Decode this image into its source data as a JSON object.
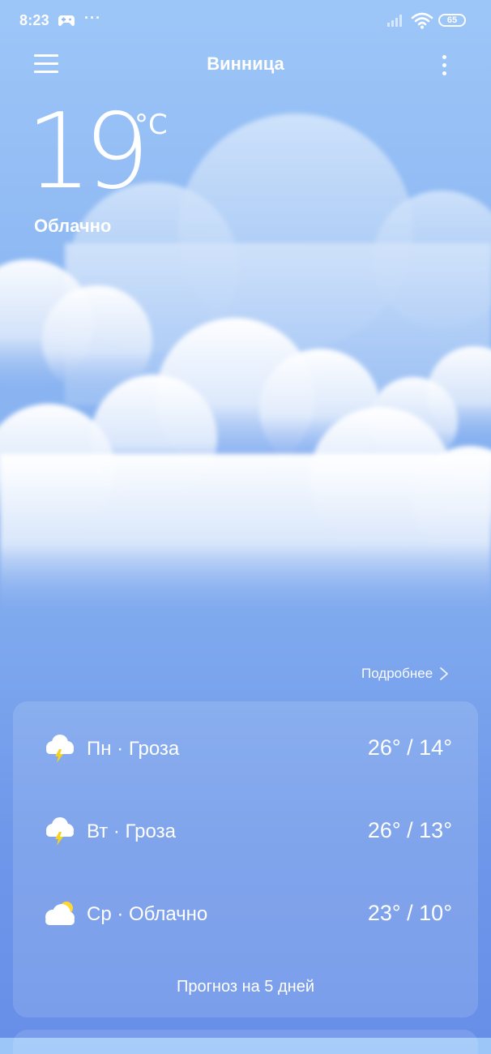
{
  "status_bar": {
    "time": "8:23",
    "more_dots": "···",
    "battery_level": "65",
    "icons": [
      "gamepad-icon",
      "more-dots-icon",
      "signal-icon",
      "wifi-icon",
      "battery-icon"
    ]
  },
  "header": {
    "city": "Винница",
    "icons": [
      "menu-icon",
      "overflow-menu-icon"
    ]
  },
  "current": {
    "temperature": "19",
    "unit": "°C",
    "condition": "Облачно"
  },
  "details_link": {
    "label": "Подробнее",
    "icon": "chevron-right-icon"
  },
  "forecast": {
    "days": [
      {
        "label": "Пн · Гроза",
        "temps": "26° / 14°",
        "icon": "thunderstorm-icon"
      },
      {
        "label": "Вт · Гроза",
        "temps": "26° / 13°",
        "icon": "thunderstorm-icon"
      },
      {
        "label": "Ср · Облачно",
        "temps": "23° / 10°",
        "icon": "partly-cloudy-icon"
      }
    ],
    "five_day_label": "Прогноз на 5 дней"
  },
  "colors": {
    "background_top": "#9dc6f8",
    "background_bottom": "#678fe8",
    "text": "#ffffff",
    "lightning": "#f5d21f",
    "sun": "#ffd633"
  }
}
